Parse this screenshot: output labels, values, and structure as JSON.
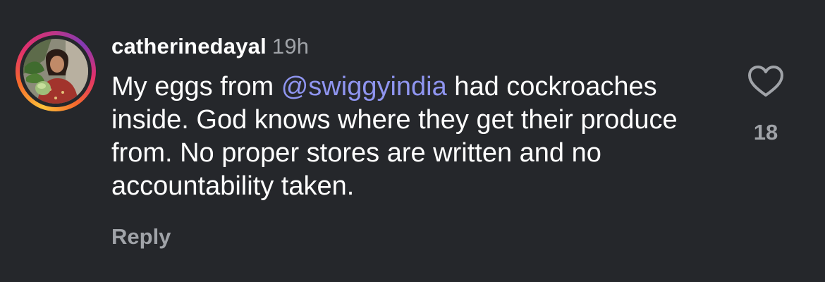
{
  "comment": {
    "username": "catherinedayal",
    "timestamp": "19h",
    "text_before": "My eggs from ",
    "mention": "@swiggyindia",
    "text_after": " had cockroaches inside. God knows where they get their produce from. No proper stores are written and no accountability taken.",
    "reply_label": "Reply",
    "like_count": "18",
    "avatar_icon": "profile-photo",
    "like_icon": "heart-outline-icon"
  },
  "colors": {
    "background": "#25272b",
    "text": "#ffffff",
    "muted": "#a0a3a8",
    "mention": "#8f95f0"
  }
}
